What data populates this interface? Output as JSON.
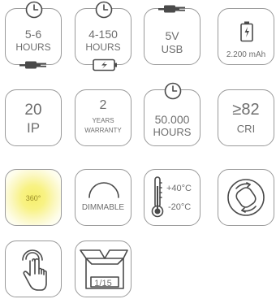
{
  "tiles": {
    "lifetime_short": {
      "line1": "5-6",
      "line2": "HOURS"
    },
    "lifetime_charge": {
      "line1": "4-150",
      "line2": "HOURS"
    },
    "usb": {
      "line1": "5V",
      "line2": "USB"
    },
    "battery": {
      "label": "2.200 mAh"
    },
    "ip": {
      "line1": "20",
      "line2": "IP"
    },
    "warranty": {
      "line1": "2",
      "line2": "YEARS",
      "line3": "WARRANTY"
    },
    "lifetime_long": {
      "line1": "50.000",
      "line2": "HOURS"
    },
    "cri": {
      "line1": "≥82",
      "line2": "CRI"
    },
    "beam": {
      "label": "360°",
      "glow_color": "#f3e85a"
    },
    "dimmable": {
      "label": "DIMMABLE"
    },
    "temperature": {
      "max": "+40°C",
      "min": "-20°C"
    },
    "rotatable": {},
    "touch": {},
    "package": {
      "label": "1/15"
    }
  },
  "colors": {
    "border": "#9a9a9a",
    "text": "#6e6e6e",
    "icon": "#4a4a4a"
  },
  "icons": [
    "clock-icon",
    "plug-icon",
    "charging-battery-icon",
    "usb-plug-icon",
    "battery-icon",
    "dimmer-arc-icon",
    "thermometer-icon",
    "rotate-icon",
    "touch-hand-icon",
    "box-icon"
  ]
}
